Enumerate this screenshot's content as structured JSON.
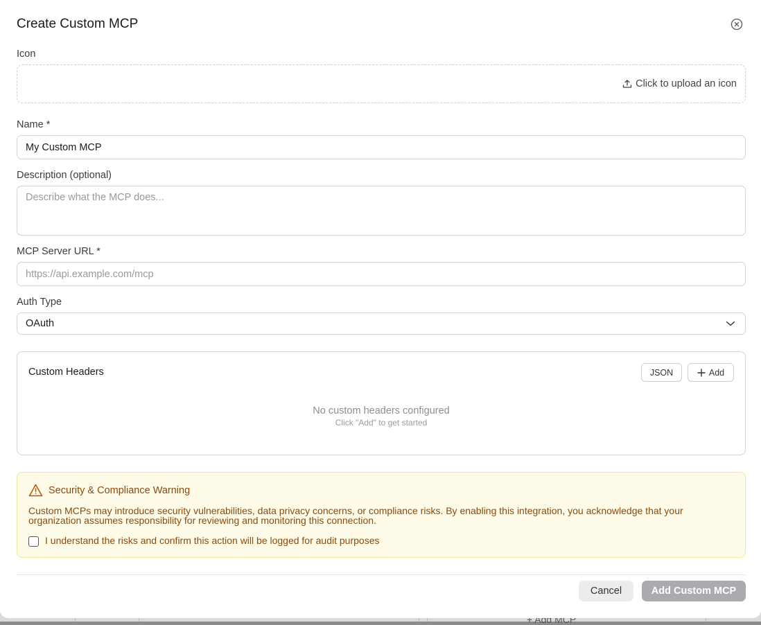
{
  "dialog": {
    "title": "Create Custom MCP"
  },
  "icon_field": {
    "label": "Icon",
    "upload_text": "Click to upload an icon"
  },
  "name_field": {
    "label": "Name *",
    "value": "My Custom MCP"
  },
  "description_field": {
    "label": "Description (optional)",
    "placeholder": "Describe what the MCP does..."
  },
  "url_field": {
    "label": "MCP Server URL *",
    "placeholder": "https://api.example.com/mcp"
  },
  "auth_field": {
    "label": "Auth Type",
    "selected": "OAuth"
  },
  "headers": {
    "title": "Custom Headers",
    "json_label": "JSON",
    "add_label": "Add",
    "empty_title": "No custom headers configured",
    "empty_hint": "Click \"Add\" to get started"
  },
  "warning": {
    "title": "Security & Compliance Warning",
    "body": "Custom MCPs may introduce security vulnerabilities, data privacy concerns, or compliance risks. By enabling this integration, you acknowledge that your organization assumes responsibility for reviewing and monitoring this connection.",
    "checkbox_label": "I understand the risks and confirm this action will be logged for audit purposes",
    "checked": false,
    "color": "#8a4a0e"
  },
  "footer": {
    "cancel_label": "Cancel",
    "submit_label": "Add Custom MCP"
  },
  "background": {
    "partial_button": "+ Add MCP"
  }
}
